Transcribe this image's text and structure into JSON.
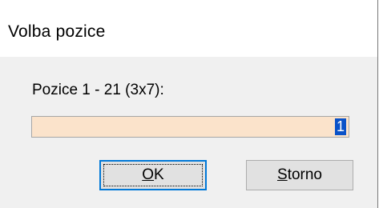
{
  "dialog": {
    "title": "Volba pozice",
    "field_label": "Pozice 1 - 21 (3x7):",
    "field_value": "1",
    "ok_accel": "O",
    "ok_rest": "K",
    "cancel_accel": "S",
    "cancel_rest": "torno"
  },
  "colors": {
    "input_background": "#fbe3cb",
    "selection": "#0a52c8",
    "default_button_border": "#0078d7",
    "dialog_background": "#f0f0f0"
  }
}
